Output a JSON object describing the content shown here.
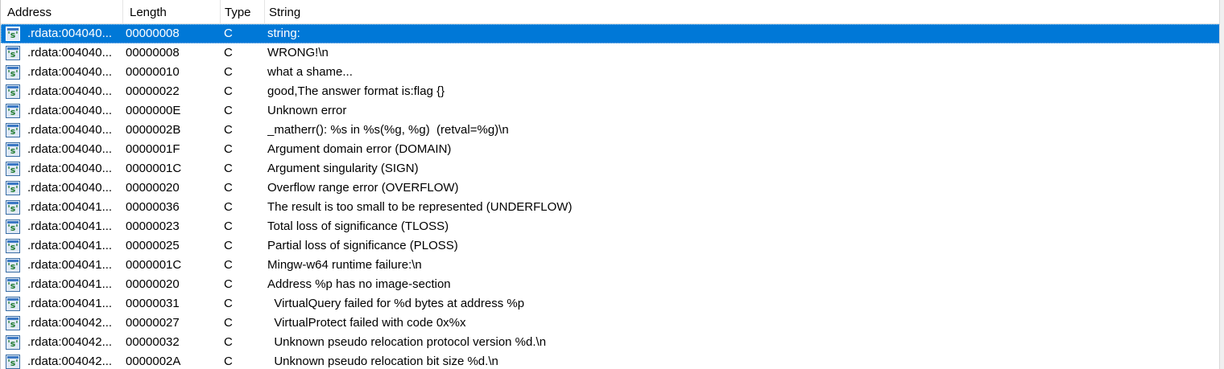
{
  "columns": {
    "address": "Address",
    "length": "Length",
    "type": "Type",
    "string": "String"
  },
  "icon": {
    "name": "string-literal-icon",
    "glyph": "'s'"
  },
  "selected_index": 0,
  "colors": {
    "selection": "#0078d7",
    "icon_s": "#1f7a2e"
  },
  "rows": [
    {
      "address": ".rdata:004040...",
      "length": "00000008",
      "type": "C",
      "string": "string:"
    },
    {
      "address": ".rdata:004040...",
      "length": "00000008",
      "type": "C",
      "string": "WRONG!\\n"
    },
    {
      "address": ".rdata:004040...",
      "length": "00000010",
      "type": "C",
      "string": "what a shame..."
    },
    {
      "address": ".rdata:004040...",
      "length": "00000022",
      "type": "C",
      "string": "good,The answer format is:flag {}"
    },
    {
      "address": ".rdata:004040...",
      "length": "0000000E",
      "type": "C",
      "string": "Unknown error"
    },
    {
      "address": ".rdata:004040...",
      "length": "0000002B",
      "type": "C",
      "string": "_matherr(): %s in %s(%g, %g)  (retval=%g)\\n"
    },
    {
      "address": ".rdata:004040...",
      "length": "0000001F",
      "type": "C",
      "string": "Argument domain error (DOMAIN)"
    },
    {
      "address": ".rdata:004040...",
      "length": "0000001C",
      "type": "C",
      "string": "Argument singularity (SIGN)"
    },
    {
      "address": ".rdata:004040...",
      "length": "00000020",
      "type": "C",
      "string": "Overflow range error (OVERFLOW)"
    },
    {
      "address": ".rdata:004041...",
      "length": "00000036",
      "type": "C",
      "string": "The result is too small to be represented (UNDERFLOW)"
    },
    {
      "address": ".rdata:004041...",
      "length": "00000023",
      "type": "C",
      "string": "Total loss of significance (TLOSS)"
    },
    {
      "address": ".rdata:004041...",
      "length": "00000025",
      "type": "C",
      "string": "Partial loss of significance (PLOSS)"
    },
    {
      "address": ".rdata:004041...",
      "length": "0000001C",
      "type": "C",
      "string": "Mingw-w64 runtime failure:\\n"
    },
    {
      "address": ".rdata:004041...",
      "length": "00000020",
      "type": "C",
      "string": "Address %p has no image-section"
    },
    {
      "address": ".rdata:004041...",
      "length": "00000031",
      "type": "C",
      "string": "  VirtualQuery failed for %d bytes at address %p"
    },
    {
      "address": ".rdata:004042...",
      "length": "00000027",
      "type": "C",
      "string": "  VirtualProtect failed with code 0x%x"
    },
    {
      "address": ".rdata:004042...",
      "length": "00000032",
      "type": "C",
      "string": "  Unknown pseudo relocation protocol version %d.\\n"
    },
    {
      "address": ".rdata:004042...",
      "length": "0000002A",
      "type": "C",
      "string": "  Unknown pseudo relocation bit size %d.\\n"
    }
  ]
}
